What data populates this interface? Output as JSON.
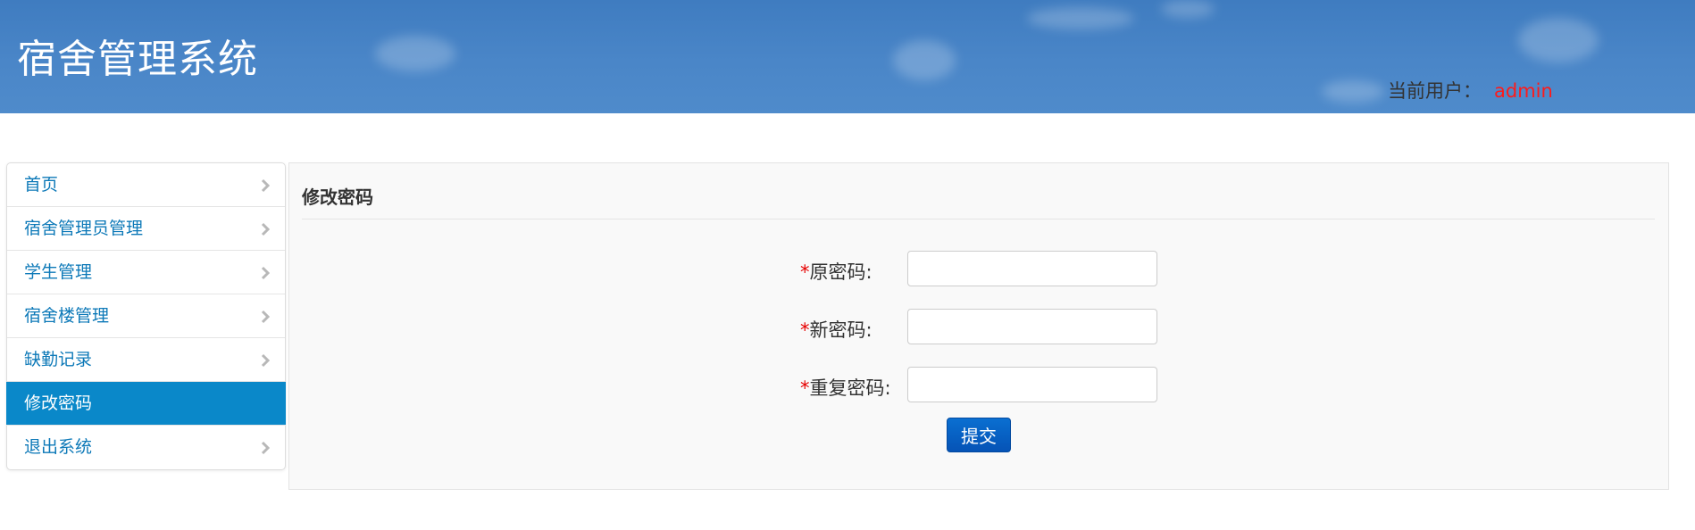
{
  "header": {
    "app_title": "宿舍管理系统",
    "user_label": "当前用户：",
    "user_name": "admin"
  },
  "sidebar": {
    "items": [
      {
        "label": "首页",
        "active": false
      },
      {
        "label": "宿舍管理员管理",
        "active": false
      },
      {
        "label": "学生管理",
        "active": false
      },
      {
        "label": "宿舍楼管理",
        "active": false
      },
      {
        "label": "缺勤记录",
        "active": false
      },
      {
        "label": "修改密码",
        "active": true
      },
      {
        "label": "退出系统",
        "active": false
      }
    ]
  },
  "main": {
    "title": "修改密码",
    "form": {
      "required_mark": "*",
      "old_password_label": "原密码:",
      "old_password_value": "",
      "new_password_label": "新密码:",
      "new_password_value": "",
      "repeat_password_label": "重复密码:",
      "repeat_password_value": "",
      "submit_label": "提交"
    }
  },
  "colors": {
    "header_bg": "#4a86c8",
    "sidebar_active": "#0a88c9",
    "link": "#0d79b8",
    "user_name": "#ff1a1a",
    "required": "#e60000",
    "button": "#0553b6"
  },
  "icons": {
    "nav_arrow": "chevron-right-icon"
  }
}
